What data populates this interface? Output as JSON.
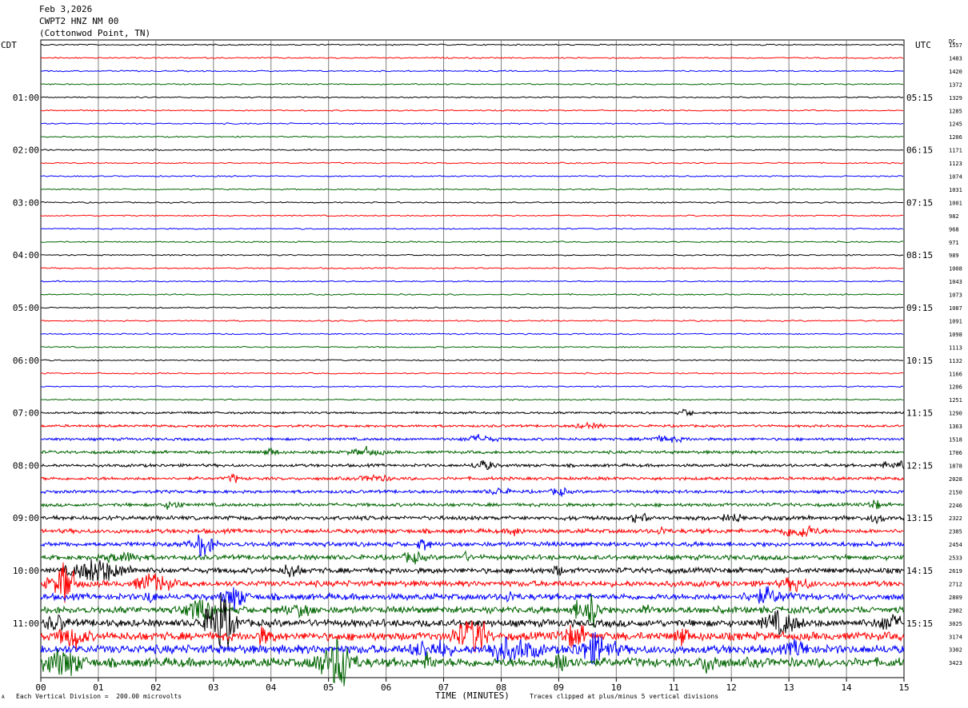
{
  "header": {
    "date": "Feb 3,2026",
    "station": "CWPT2 HNZ NM 00",
    "location": "(Cottonwod Point, TN)"
  },
  "left_timezone": "CDT",
  "right_timezone": "UTC",
  "dc_label": "DC",
  "footer": {
    "scale_note": "Each Vertical Division =  200.00 microvolts",
    "clip_note": "Traces clipped at plus/minus 5 vertical divisions",
    "corner_mark": "A"
  },
  "colors": {
    "trace_cycle": [
      "#000000",
      "#ff0000",
      "#0000ff",
      "#006400"
    ],
    "grid": "#7f7f7f"
  },
  "chart_data": {
    "type": "line",
    "title": "Feb 3,2026",
    "xlabel": "TIME (MINUTES)",
    "ylabel": "",
    "xlim": [
      0,
      15
    ],
    "x_ticks": [
      "00",
      "01",
      "02",
      "03",
      "04",
      "05",
      "06",
      "07",
      "08",
      "09",
      "10",
      "11",
      "12",
      "13",
      "14",
      "15"
    ],
    "left_hour_labels": [
      "01:00",
      "02:00",
      "03:00",
      "04:00",
      "05:00",
      "06:00",
      "07:00",
      "08:00",
      "09:00",
      "10:00",
      "11:00"
    ],
    "right_hour_labels": [
      "05:15",
      "06:15",
      "07:15",
      "08:15",
      "09:15",
      "10:15",
      "11:15",
      "12:15",
      "13:15",
      "14:15",
      "15:15"
    ],
    "dc_values": [
      "1557",
      "1483",
      "1420",
      "1372",
      "1329",
      "1285",
      "1245",
      "1206",
      "1171",
      "1123",
      "1074",
      "1031",
      "1001",
      "982",
      "968",
      "971",
      "989",
      "1008",
      "1043",
      "1073",
      "1087",
      "1091",
      "1098",
      "1113",
      "1132",
      "1166",
      "1206",
      "1251",
      "1290",
      "1363",
      "1518",
      "1706",
      "1878",
      "2028",
      "2150",
      "2246",
      "2322",
      "2385",
      "2454",
      "2533",
      "2619",
      "2712",
      "2809",
      "2902",
      "3025",
      "3174",
      "3302",
      "3423"
    ],
    "trace_amplitude": [
      1,
      1,
      1,
      1,
      1,
      1,
      1,
      1,
      1,
      1,
      1,
      1,
      1,
      1,
      1,
      1,
      1,
      1,
      1,
      1,
      1,
      1,
      1,
      1,
      1,
      1,
      1,
      1,
      1.6,
      1.8,
      2,
      2.2,
      2.2,
      2.3,
      2.3,
      2.5,
      3,
      3.2,
      3.4,
      3.6,
      4,
      4.3,
      4.6,
      5,
      5.4,
      6,
      6.4,
      6.8
    ]
  }
}
